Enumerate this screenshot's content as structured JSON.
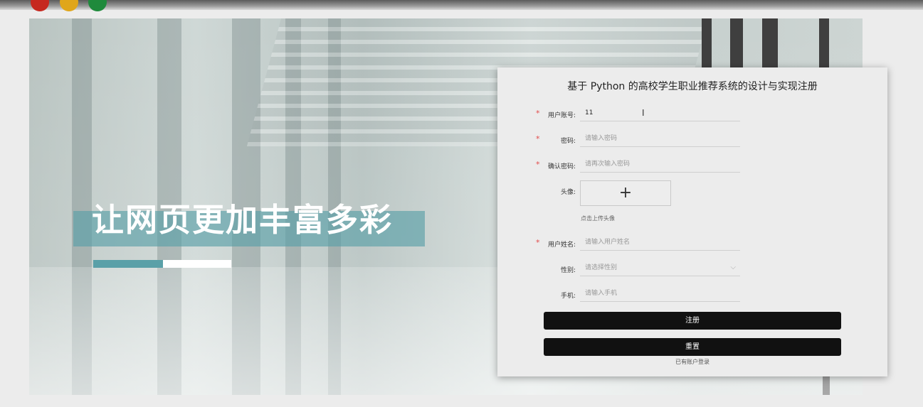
{
  "hero": {
    "title": "让网页更加丰富多彩"
  },
  "form": {
    "title": "基于 Python 的高校学生职业推荐系统的设计与实现注册",
    "fields": [
      {
        "label": "用户账号:",
        "required": true,
        "value": "11",
        "placeholder": ""
      },
      {
        "label": "密码:",
        "required": true,
        "value": "",
        "placeholder": "请输入密码"
      },
      {
        "label": "确认密码:",
        "required": true,
        "value": "",
        "placeholder": "请再次输入密码"
      },
      {
        "label": "用户姓名:",
        "required": true,
        "value": "",
        "placeholder": "请输入用户姓名"
      },
      {
        "label": "性别:",
        "required": false,
        "value": "",
        "placeholder": "请选择性别"
      },
      {
        "label": "手机:",
        "required": false,
        "value": "",
        "placeholder": "请输入手机"
      }
    ],
    "avatar": {
      "label": "头像:",
      "plus": "+",
      "tip": "点击上传头像"
    },
    "required_mark": "*",
    "register_button": "注册",
    "reset_button": "重置",
    "login_link": "已有账户登录"
  },
  "icons": {
    "cursor": "text-cursor-icon",
    "chevron": "chevron-down-icon"
  },
  "colors": {
    "accent": "#5aa0a8",
    "button": "#111111",
    "required": "#e24b4b"
  }
}
